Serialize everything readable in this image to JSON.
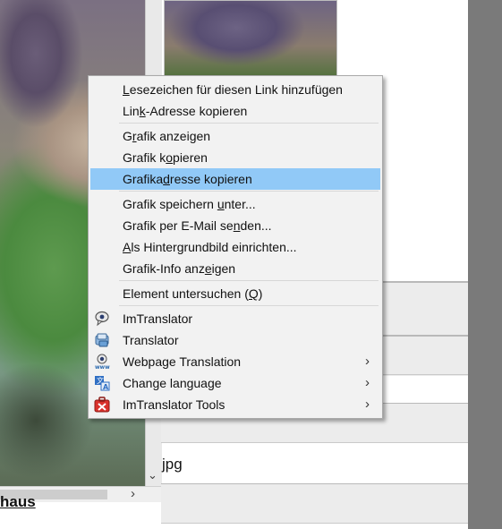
{
  "background": {
    "jpg_text": "jpg",
    "bottom_link": "haus",
    "scroll_right_glyph": "›",
    "scroll_down_glyph": "⌄"
  },
  "menu": {
    "groups": [
      [
        {
          "id": "add-bookmark",
          "pre": "",
          "accel": "L",
          "post": "esezeichen für diesen Link hinzufügen"
        },
        {
          "id": "copy-link",
          "pre": "Lin",
          "accel": "k",
          "post": "-Adresse kopieren"
        }
      ],
      [
        {
          "id": "view-image",
          "pre": "G",
          "accel": "r",
          "post": "afik anzeigen"
        },
        {
          "id": "copy-image",
          "pre": "Grafik k",
          "accel": "o",
          "post": "pieren"
        },
        {
          "id": "copy-image-address",
          "pre": "Grafika",
          "accel": "d",
          "post": "resse kopieren",
          "highlighted": true
        }
      ],
      [
        {
          "id": "save-image",
          "pre": "Grafik speichern ",
          "accel": "u",
          "post": "nter..."
        },
        {
          "id": "email-image",
          "pre": "Grafik per E-Mail se",
          "accel": "n",
          "post": "den..."
        },
        {
          "id": "set-background",
          "pre": "",
          "accel": "A",
          "post": "ls Hintergrundbild einrichten..."
        },
        {
          "id": "image-info",
          "pre": "Grafik-Info anz",
          "accel": "e",
          "post": "igen"
        }
      ],
      [
        {
          "id": "inspect-element",
          "pre": "Element untersuchen (",
          "accel": "Q",
          "post": ")"
        }
      ],
      [
        {
          "id": "imtranslator",
          "pre": "ImTranslator",
          "accel": "",
          "post": "",
          "icon": "speech-bubble-icon"
        },
        {
          "id": "translator",
          "pre": "Translator",
          "accel": "",
          "post": "",
          "icon": "translator-window-icon"
        },
        {
          "id": "webpage-translation",
          "pre": "Webpage Translation",
          "accel": "",
          "post": "",
          "icon": "globe-www-icon",
          "submenu": true
        },
        {
          "id": "change-language",
          "pre": "Change language",
          "accel": "",
          "post": "",
          "icon": "language-swap-icon",
          "submenu": true
        },
        {
          "id": "imtranslator-tools",
          "pre": "ImTranslator Tools",
          "accel": "",
          "post": "",
          "icon": "toolbox-icon",
          "submenu": true
        }
      ]
    ],
    "submenu_glyph": "›",
    "colors": {
      "highlight": "#91c9f7",
      "background": "#f2f2f2"
    }
  }
}
